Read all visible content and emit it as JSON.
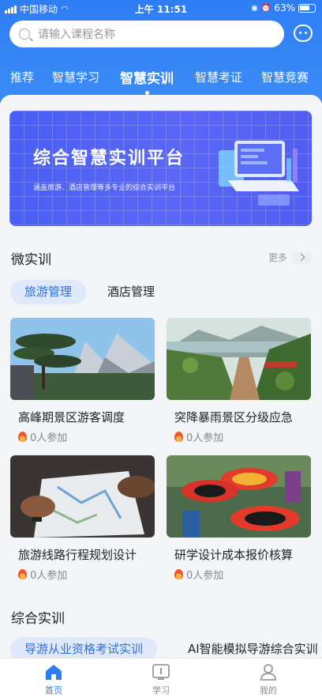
{
  "status_bar": {
    "carrier": "中国移动",
    "time": "上午 11:51",
    "battery": "63%"
  },
  "search": {
    "placeholder": "请输入课程名称"
  },
  "tabs": [
    {
      "label": "推荐"
    },
    {
      "label": "智慧学习"
    },
    {
      "label": "智慧实训",
      "active": true
    },
    {
      "label": "智慧考证"
    },
    {
      "label": "智慧竞赛"
    }
  ],
  "banner": {
    "title": "综合智慧实训平台",
    "subtitle": "涵盖旅游、酒店管理等多专业的综合实训平台"
  },
  "micro_training": {
    "title": "微实训",
    "more_label": "更多",
    "categories": [
      {
        "label": "旅游管理",
        "selected": true
      },
      {
        "label": "酒店管理"
      }
    ],
    "cards": [
      {
        "title": "高峰期景区游客调度",
        "participants": "0人参加",
        "image": "pine-mountain"
      },
      {
        "title": "突降暴雨景区分级应急",
        "participants": "0人参加",
        "image": "lake-trail"
      },
      {
        "title": "旅游线路行程规划设计",
        "participants": "0人参加",
        "image": "map-planning"
      },
      {
        "title": "研学设计成本报价核算",
        "participants": "0人参加",
        "image": "folk-umbrellas"
      }
    ]
  },
  "comprehensive": {
    "title": "综合实训",
    "chips": [
      {
        "label": "导游从业资格考试实训",
        "selected": true
      },
      {
        "label": "AI智能模拟导游综合实训"
      }
    ]
  },
  "bottom_nav": [
    {
      "label": "首页",
      "icon": "home-icon",
      "active": true
    },
    {
      "label": "学习",
      "icon": "study-icon"
    },
    {
      "label": "我的",
      "icon": "profile-icon"
    }
  ],
  "colors": {
    "brand": "#2f7df5",
    "pill_bg": "#dfe9fb",
    "pill_text": "#2f6fd6",
    "banner": "#4f5df0"
  }
}
